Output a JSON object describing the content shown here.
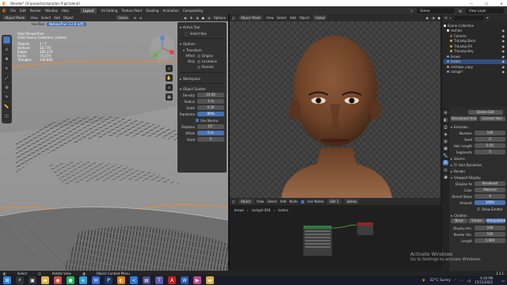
{
  "window": {
    "title": "Blender* [A:\\projects\\character lf girl.blend]",
    "controls": [
      "—",
      "☐",
      "✕"
    ]
  },
  "menu": [
    "File",
    "Edit",
    "Render",
    "Window",
    "Help"
  ],
  "workspaces": [
    "Layout",
    "UV Editing",
    "Texture Paint",
    "Shading",
    "Animation",
    "Compositing"
  ],
  "scene_name": "Scene",
  "viewlayer_name": "View Layer",
  "left_view": {
    "mode": "Object Mode",
    "menu": [
      "View",
      "Select",
      "Add",
      "Object"
    ],
    "orientation": "Global",
    "overlay_title": "User Perspective",
    "overlay_sub": "(183) Scene Collection | lashes",
    "stats": [
      {
        "k": "Objects",
        "v": "1 / 7"
      },
      {
        "k": "Vertices",
        "v": "16,770"
      },
      {
        "k": "Edges",
        "v": "180,170"
      },
      {
        "k": "Faces",
        "v": "74,479"
      },
      {
        "k": "Triangles",
        "v": "146,893"
      }
    ],
    "addon_label": "HairTool",
    "addon_field": "Nahaa/True 3.2.6 (off)"
  },
  "npanel": {
    "tab_label": "Options",
    "active_tool_title": "Active Tool",
    "active_tool_value": "Select Box",
    "options_title": "Options",
    "transform_title": "Transform",
    "affect_only_label": "Affect Only",
    "affect_options": [
      "Origins",
      "Locations",
      "Parents"
    ],
    "workspace_title": "Workspace",
    "scatter_title": "Object Scatter",
    "scatter_rows": [
      {
        "label": "Density",
        "value": "10.00",
        "blue": false
      },
      {
        "label": "Radius",
        "value": "1 m",
        "blue": false
      },
      {
        "label": "Scale",
        "value": "0.30",
        "blue": false
      },
      {
        "label": "Randomn.",
        "value": "80%",
        "blue": true
      },
      {
        "label": "Use Norma",
        "value": "",
        "blue": false
      },
      {
        "label": "Rotation",
        "value": "15°",
        "blue": false
      },
      {
        "label": "Offset",
        "value": "0 m",
        "blue": true
      },
      {
        "label": "Seed",
        "value": "0",
        "blue": false
      }
    ]
  },
  "right_view": {
    "mode": "Object Mode",
    "menu": [
      "View",
      "Select",
      "Add",
      "Object"
    ],
    "orientation": "Global"
  },
  "node_editor": {
    "editor": "Object",
    "menu": [
      "View",
      "Select",
      "Add",
      "Node"
    ],
    "use_nodes": "Use Nodes",
    "slot": "Slot 1",
    "material": "lashes",
    "breadcrumb": [
      "brows",
      "rackgirl.004",
      "lashes"
    ]
  },
  "outliner": {
    "title": "Scene Collection",
    "items": [
      {
        "label": "Scene Collection",
        "color": "#ffffff",
        "indent": 0
      },
      {
        "label": "roshies",
        "color": "#ffffff",
        "indent": 1
      },
      {
        "label": "Camera",
        "color": "#9a6a3a",
        "indent": 2
      },
      {
        "label": "TnLamp.Back",
        "color": "#caa24b",
        "indent": 2
      },
      {
        "label": "TnLamp.Fill",
        "color": "#caa24b",
        "indent": 2
      },
      {
        "label": "TnLamp.Key",
        "color": "#caa24b",
        "indent": 2
      },
      {
        "label": "brows",
        "color": "#5aa0e0",
        "indent": 1
      },
      {
        "label": "lashes",
        "color": "#5aa0e0",
        "indent": 1
      },
      {
        "label": "mixtape_copy",
        "color": "#e08a4a",
        "indent": 1
      },
      {
        "label": "rackgirl",
        "color": "#5aa0e0",
        "indent": 1
      }
    ]
  },
  "properties": {
    "buttons": [
      "Delete Edit",
      "Disconnect Hair",
      "Connect Hair"
    ],
    "emission_title": "Emission",
    "emission_rows": [
      {
        "label": "Number",
        "value": "100"
      },
      {
        "label": "Seed",
        "value": "0"
      },
      {
        "label": "Hair Length",
        "value": "0.50"
      },
      {
        "label": "Segments",
        "value": "5"
      }
    ],
    "source_title": "Source",
    "hair_dynamics": "Hair Dynamics",
    "render_title": "Render",
    "viewport_title": "Viewport Display",
    "display_as_label": "Display As",
    "display_as_value": "Rendered",
    "color_label": "Color",
    "color_value": "Material",
    "strand_steps_label": "Strand Steps",
    "strand_steps_value": "4",
    "amount_label": "Amount",
    "amount_value": "100%",
    "show_emitter": "Show Emitter",
    "children_title": "Children",
    "children_modes": [
      "None",
      "Simple",
      "Interpolated"
    ],
    "children_rows": [
      {
        "label": "Display Am.",
        "value": "100"
      },
      {
        "label": "Render Am.",
        "value": "100"
      },
      {
        "label": "Length",
        "value": "1.000"
      }
    ]
  },
  "statusbar": {
    "left": "Select",
    "mid": "Rotate View",
    "right": "Object Context Menu",
    "version": "3.3.1"
  },
  "watermark": {
    "line1": "Activate Windows",
    "line2": "Go to Settings to activate Windows."
  },
  "taskbar": {
    "apps": [
      {
        "name": "windows-icon",
        "color": "#2b88d8",
        "glyph": "⊞"
      },
      {
        "name": "search-icon",
        "color": "#333333",
        "glyph": "⌕"
      },
      {
        "name": "taskview-icon",
        "color": "#333333",
        "glyph": "▣"
      },
      {
        "name": "explorer-icon",
        "color": "#e0b040",
        "glyph": "▬"
      },
      {
        "name": "chrome-icon",
        "color": "#d04a3a",
        "glyph": "◉"
      },
      {
        "name": "spotify-icon",
        "color": "#1db954",
        "glyph": "●"
      },
      {
        "name": "edge-icon",
        "color": "#2f9dd8",
        "glyph": "e"
      },
      {
        "name": "mail-icon",
        "color": "#3a6ad8",
        "glyph": "✉"
      },
      {
        "name": "photoshop-icon",
        "color": "#1a3a6a",
        "glyph": "P"
      },
      {
        "name": "blender-icon",
        "color": "#e87d0d",
        "glyph": "◐"
      },
      {
        "name": "vscode-icon",
        "color": "#2a7ad0",
        "glyph": "≺"
      },
      {
        "name": "store-icon",
        "color": "#4a4a8a",
        "glyph": "▤"
      },
      {
        "name": "teams-icon",
        "color": "#5a5ab0",
        "glyph": "T"
      },
      {
        "name": "acrobat-icon",
        "color": "#c02020",
        "glyph": "A"
      },
      {
        "name": "word-icon",
        "color": "#2a5aa8",
        "glyph": "W"
      },
      {
        "name": "media-icon",
        "color": "#c04a8a",
        "glyph": "▶"
      },
      {
        "name": "folder-icon",
        "color": "#d8b040",
        "glyph": "▬"
      }
    ],
    "weather": "32°C  Sunny",
    "time": "9:19 PM",
    "date": "15/11/2022"
  }
}
